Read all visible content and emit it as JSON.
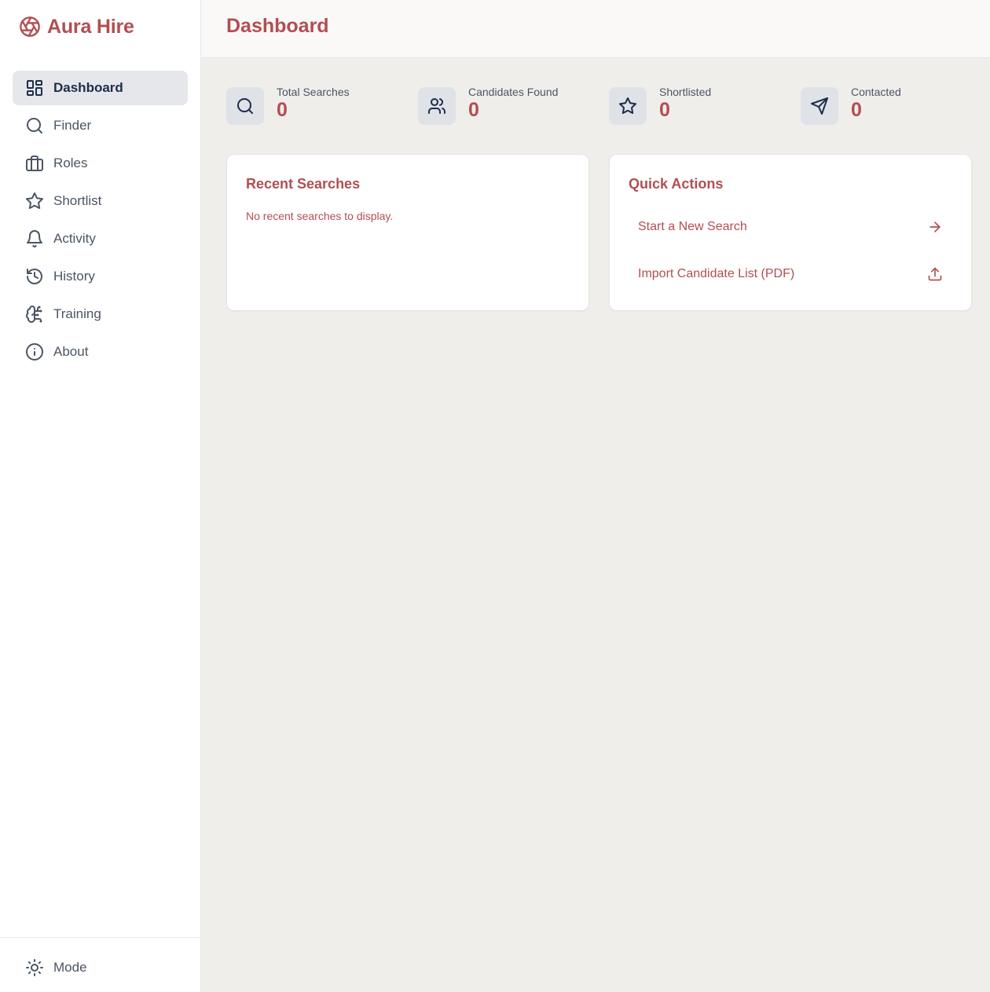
{
  "brand": {
    "name": "Aura Hire",
    "icon": "aperture-icon",
    "color": "#b24e52"
  },
  "sidebar": {
    "items": [
      {
        "label": "Dashboard",
        "icon": "layout-dashboard-icon",
        "active": true
      },
      {
        "label": "Finder",
        "icon": "search-icon"
      },
      {
        "label": "Roles",
        "icon": "briefcase-icon"
      },
      {
        "label": "Shortlist",
        "icon": "star-icon"
      },
      {
        "label": "Activity",
        "icon": "bell-icon"
      },
      {
        "label": "History",
        "icon": "history-icon"
      },
      {
        "label": "Training",
        "icon": "brain-icon"
      },
      {
        "label": "About",
        "icon": "info-icon"
      }
    ],
    "mode_label": "Mode",
    "mode_icon": "sun-icon"
  },
  "header": {
    "title": "Dashboard"
  },
  "stats": [
    {
      "label": "Total Searches",
      "value": "0",
      "icon": "search-icon"
    },
    {
      "label": "Candidates Found",
      "value": "0",
      "icon": "users-icon"
    },
    {
      "label": "Shortlisted",
      "value": "0",
      "icon": "star-icon"
    },
    {
      "label": "Contacted",
      "value": "0",
      "icon": "send-icon"
    }
  ],
  "recent_searches": {
    "title": "Recent Searches",
    "empty_text": "No recent searches to display."
  },
  "quick_actions": {
    "title": "Quick Actions",
    "items": [
      {
        "label": "Start a New Search",
        "icon": "arrow-right-icon"
      },
      {
        "label": "Import Candidate List (PDF)",
        "icon": "upload-icon"
      }
    ]
  },
  "colors": {
    "accent": "#b24e52",
    "navy": "#1e2d4a",
    "background": "#f0eeeb"
  }
}
